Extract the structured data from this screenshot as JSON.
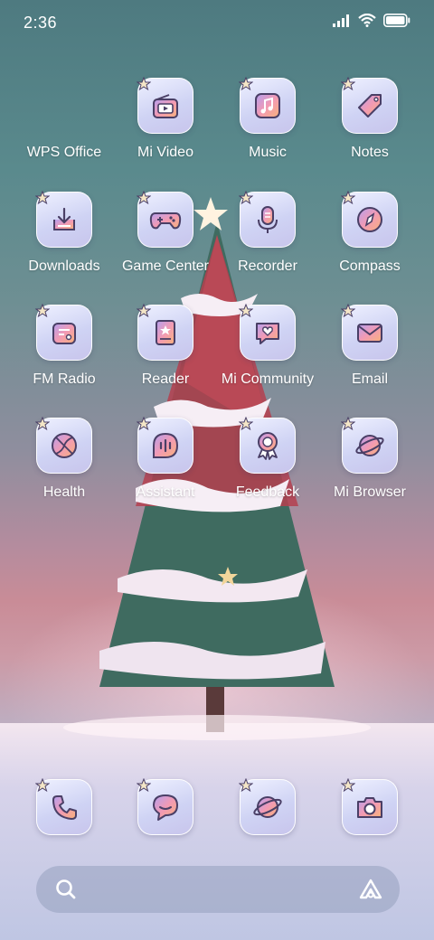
{
  "status_bar": {
    "time": "2:36",
    "icons": [
      "signal-icon",
      "wifi-icon",
      "battery-icon"
    ]
  },
  "apps": [
    {
      "name": "wps-office",
      "label": "WPS Office",
      "icon": "none"
    },
    {
      "name": "mi-video",
      "label": "Mi Video",
      "icon": "video-icon"
    },
    {
      "name": "music",
      "label": "Music",
      "icon": "music-note-icon"
    },
    {
      "name": "notes",
      "label": "Notes",
      "icon": "tag-icon"
    },
    {
      "name": "downloads",
      "label": "Downloads",
      "icon": "download-icon"
    },
    {
      "name": "game-center",
      "label": "Game Center",
      "icon": "gamepad-icon"
    },
    {
      "name": "recorder",
      "label": "Recorder",
      "icon": "microphone-icon"
    },
    {
      "name": "compass",
      "label": "Compass",
      "icon": "compass-icon"
    },
    {
      "name": "fm-radio",
      "label": "FM Radio",
      "icon": "radio-icon"
    },
    {
      "name": "reader",
      "label": "Reader",
      "icon": "book-icon"
    },
    {
      "name": "mi-community",
      "label": "Mi Community",
      "icon": "heart-chat-icon"
    },
    {
      "name": "email",
      "label": "Email",
      "icon": "envelope-icon"
    },
    {
      "name": "health",
      "label": "Health",
      "icon": "ball-icon"
    },
    {
      "name": "assistant",
      "label": "Assistant",
      "icon": "voice-wave-icon"
    },
    {
      "name": "feedback",
      "label": "Feedback",
      "icon": "award-icon"
    },
    {
      "name": "mi-browser",
      "label": "Mi Browser",
      "icon": "planet-icon"
    }
  ],
  "dock": [
    {
      "name": "phone",
      "icon": "phone-icon"
    },
    {
      "name": "messages",
      "icon": "chat-bubble-icon"
    },
    {
      "name": "browser",
      "icon": "planet-icon"
    },
    {
      "name": "camera",
      "icon": "camera-icon"
    }
  ],
  "search": {
    "icons": [
      "search-icon",
      "assistant-logo-icon"
    ]
  },
  "colors": {
    "icon_stroke": "#4a3f66",
    "accent_pink": "#f29ab4",
    "accent_orange": "#f7b27a",
    "accent_purple": "#b4a0f0"
  }
}
